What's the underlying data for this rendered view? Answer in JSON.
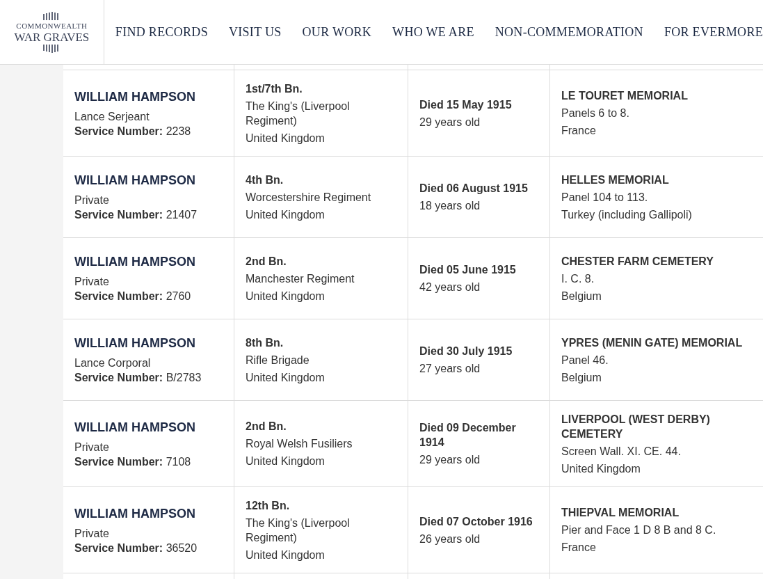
{
  "logo": {
    "line1": "COMMONWEALTH",
    "line2": "WAR GRAVES"
  },
  "nav": [
    "FIND RECORDS",
    "VISIT US",
    "OUR WORK",
    "WHO WE ARE",
    "NON-COMMEMORATION",
    "FOR EVERMORE"
  ],
  "records": [
    {
      "name": "WILLIAM HAMPSON",
      "rank": "Lance Serjeant",
      "service_label": "Service Number:",
      "service_number": "2238",
      "unit": "1st/7th Bn.",
      "regiment": "The King's (Liverpool Regiment)",
      "country": "United Kingdom",
      "died": "Died 15 May 1915",
      "age": "29 years old",
      "cemetery": "LE TOURET MEMORIAL",
      "grave": "Panels 6 to 8.",
      "cemetery_country": "France"
    },
    {
      "name": "WILLIAM HAMPSON",
      "rank": "Private",
      "service_label": "Service Number:",
      "service_number": "21407",
      "unit": "4th Bn.",
      "regiment": "Worcestershire Regiment",
      "country": "United Kingdom",
      "died": "Died 06 August 1915",
      "age": "18 years old",
      "cemetery": "HELLES MEMORIAL",
      "grave": "Panel 104 to 113.",
      "cemetery_country": "Turkey (including Gallipoli)"
    },
    {
      "name": "WILLIAM HAMPSON",
      "rank": "Private",
      "service_label": "Service Number:",
      "service_number": "2760",
      "unit": "2nd Bn.",
      "regiment": "Manchester Regiment",
      "country": "United Kingdom",
      "died": "Died 05 June 1915",
      "age": "42 years old",
      "cemetery": "CHESTER FARM CEMETERY",
      "grave": "I. C. 8.",
      "cemetery_country": "Belgium"
    },
    {
      "name": "WILLIAM HAMPSON",
      "rank": "Lance Corporal",
      "service_label": "Service Number:",
      "service_number": "B/2783",
      "unit": "8th Bn.",
      "regiment": "Rifle Brigade",
      "country": "United Kingdom",
      "died": "Died 30 July 1915",
      "age": "27 years old",
      "cemetery": "YPRES (MENIN GATE) MEMORIAL",
      "grave": "Panel 46.",
      "cemetery_country": "Belgium"
    },
    {
      "name": "WILLIAM HAMPSON",
      "rank": "Private",
      "service_label": "Service Number:",
      "service_number": "7108",
      "unit": "2nd Bn.",
      "regiment": "Royal Welsh Fusiliers",
      "country": "United Kingdom",
      "died": "Died 09 December 1914",
      "age": "29 years old",
      "cemetery": "LIVERPOOL (WEST DERBY) CEMETERY",
      "grave": "Screen Wall. XI. CE. 44.",
      "cemetery_country": "United Kingdom"
    },
    {
      "name": "WILLIAM HAMPSON",
      "rank": "Private",
      "service_label": "Service Number:",
      "service_number": "36520",
      "unit": "12th Bn.",
      "regiment": "The King's (Liverpool Regiment)",
      "country": "United Kingdom",
      "died": "Died 07 October 1916",
      "age": "26 years old",
      "cemetery": "THIEPVAL MEMORIAL",
      "grave": "Pier and Face 1 D 8 B and 8 C.",
      "cemetery_country": "France"
    }
  ]
}
